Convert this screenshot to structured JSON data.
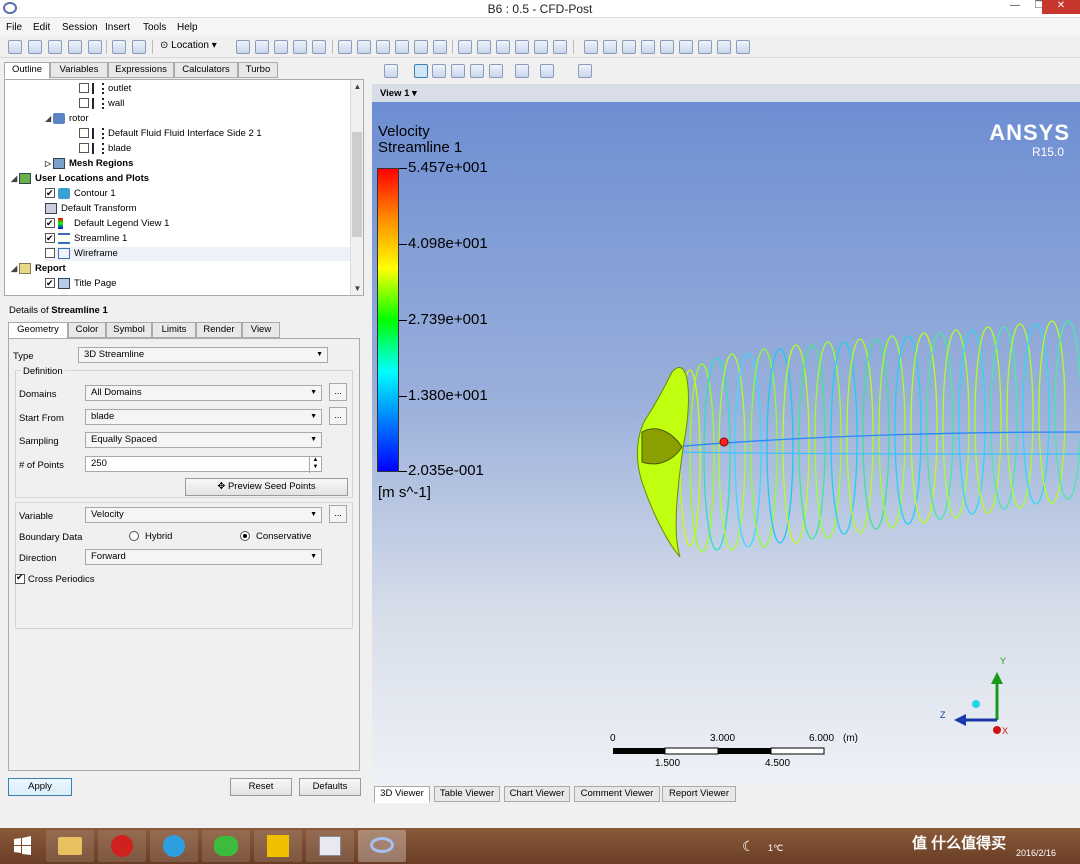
{
  "window": {
    "title": "B6 : 0.5 - CFD-Post",
    "min": "—",
    "max": "❐",
    "close": "✕"
  },
  "menu": [
    "File",
    "Edit",
    "Session",
    "Insert",
    "Tools",
    "Help"
  ],
  "toolbar": {
    "location_label": "Location"
  },
  "left_tabs": [
    "Outline",
    "Variables",
    "Expressions",
    "Calculators",
    "Turbo"
  ],
  "tree": [
    {
      "label": "outlet",
      "checked": false,
      "icon": "boundary-icon"
    },
    {
      "label": "wall",
      "checked": false,
      "icon": "boundary-icon"
    },
    {
      "label": "rotor",
      "icon": "domain-icon"
    },
    {
      "label": "Default Fluid Fluid Interface Side 2 1",
      "checked": false,
      "icon": "boundary-icon"
    },
    {
      "label": "blade",
      "checked": false,
      "icon": "boundary-icon"
    },
    {
      "label": "Mesh Regions",
      "icon": "mesh-icon"
    },
    {
      "label": "User Locations and Plots",
      "icon": "user-locations-icon"
    },
    {
      "label": "Contour 1",
      "checked": true,
      "icon": "contour-icon"
    },
    {
      "label": "Default Transform",
      "icon": "transform-icon"
    },
    {
      "label": "Default Legend View 1",
      "checked": true,
      "icon": "legend-icon"
    },
    {
      "label": "Streamline 1",
      "checked": true,
      "icon": "streamline-icon"
    },
    {
      "label": "Wireframe",
      "checked": false,
      "icon": "wireframe-icon"
    },
    {
      "label": "Report",
      "icon": "report-icon"
    },
    {
      "label": "Title Page",
      "checked": true,
      "icon": "title-page-icon"
    }
  ],
  "details": {
    "title_prefix": "Details of ",
    "title_object": "Streamline 1",
    "tabs": [
      "Geometry",
      "Color",
      "Symbol",
      "Limits",
      "Render",
      "View"
    ],
    "type_label": "Type",
    "type_value": "3D Streamline",
    "definition_label": "Definition",
    "domains_label": "Domains",
    "domains_value": "All Domains",
    "start_from_label": "Start From",
    "start_from_value": "blade",
    "sampling_label": "Sampling",
    "sampling_value": "Equally Spaced",
    "points_label": "# of Points",
    "points_value": "250",
    "preview_button": "Preview Seed Points",
    "variable_label": "Variable",
    "variable_value": "Velocity",
    "boundary_label": "Boundary Data",
    "boundary_opt1": "Hybrid",
    "boundary_opt2": "Conservative",
    "direction_label": "Direction",
    "direction_value": "Forward",
    "cross_periodics": "Cross Periodics",
    "dots": "...",
    "apply": "Apply",
    "reset": "Reset",
    "defaults": "Defaults"
  },
  "viewer": {
    "title": "View 1",
    "legend_title1": "Velocity",
    "legend_title2": "Streamline 1",
    "legend_values": [
      "5.457e+001",
      "4.098e+001",
      "2.739e+001",
      "1.380e+001",
      "2.035e-001"
    ],
    "legend_units": "[m s^-1]",
    "brand": "ANSYS",
    "version": "R15.0",
    "scale_top": [
      "0",
      "3.000",
      "6.000",
      "(m)"
    ],
    "scale_bottom": [
      "1.500",
      "4.500"
    ],
    "axis_x": "X",
    "axis_y": "Y",
    "axis_z": "Z",
    "tabs": [
      "3D Viewer",
      "Table Viewer",
      "Chart Viewer",
      "Comment Viewer",
      "Report Viewer"
    ]
  },
  "taskbar": {
    "temperature": "1℃",
    "date": "2016/2/16",
    "watermark": "值 什么值得买"
  }
}
